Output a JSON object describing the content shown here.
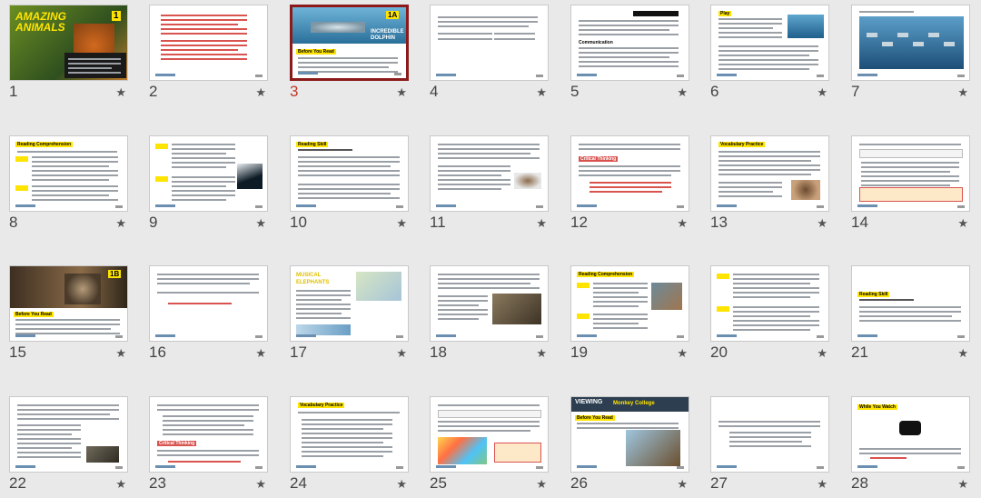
{
  "slides": [
    {
      "number": "1",
      "type": "cover-amazing"
    },
    {
      "number": "2",
      "type": "text-red"
    },
    {
      "number": "3",
      "type": "cover-dolphin",
      "selected": true
    },
    {
      "number": "4",
      "type": "text-short"
    },
    {
      "number": "5",
      "type": "text-communication"
    },
    {
      "number": "6",
      "type": "text-play-photo"
    },
    {
      "number": "7",
      "type": "photo-dolphins"
    },
    {
      "number": "8",
      "type": "reading-comp"
    },
    {
      "number": "9",
      "type": "questions-orca"
    },
    {
      "number": "10",
      "type": "reading-skill"
    },
    {
      "number": "11",
      "type": "text-bird"
    },
    {
      "number": "12",
      "type": "critical-thinking"
    },
    {
      "number": "13",
      "type": "vocab-animal"
    },
    {
      "number": "14",
      "type": "vocab-box"
    },
    {
      "number": "15",
      "type": "cover-elephant"
    },
    {
      "number": "16",
      "type": "text-red-short"
    },
    {
      "number": "17",
      "type": "musical-elephants"
    },
    {
      "number": "18",
      "type": "text-elephants-photo"
    },
    {
      "number": "19",
      "type": "reading-comp-photo"
    },
    {
      "number": "20",
      "type": "questions"
    },
    {
      "number": "21",
      "type": "reading-skill-short"
    },
    {
      "number": "22",
      "type": "text-photo-small"
    },
    {
      "number": "23",
      "type": "critical-thinking-list"
    },
    {
      "number": "24",
      "type": "vocab-list"
    },
    {
      "number": "25",
      "type": "vocab-colorful"
    },
    {
      "number": "26",
      "type": "viewing-monkey"
    },
    {
      "number": "27",
      "type": "text-few"
    },
    {
      "number": "28",
      "type": "while-you-watch"
    }
  ],
  "labels": {
    "amazing_title": "AMAZING ANIMALS",
    "unit1": "1",
    "tag_1a": "1A",
    "dolphin_title": "INCREDIBLE DOLPHIN",
    "before_you_read": "Before You Read",
    "tag_1b": "1B",
    "musical_title": "MUSICAL ELEPHANTS",
    "viewing_title": "VIEWING",
    "monkey_subtitle": "Monkey College",
    "reading_comp": "Reading Comprehension",
    "reading_skill": "Reading Skill",
    "vocab_practice": "Vocabulary Practice",
    "critical_thinking": "Critical Thinking",
    "while_you_watch": "While You Watch",
    "communication": "Communication",
    "play": "Play"
  },
  "icons": {
    "star": "star-icon"
  },
  "colors": {
    "selected_border": "#8b1a1a",
    "selected_number": "#c0392b",
    "yellow": "#ffe400",
    "red_text": "#d9534f"
  }
}
